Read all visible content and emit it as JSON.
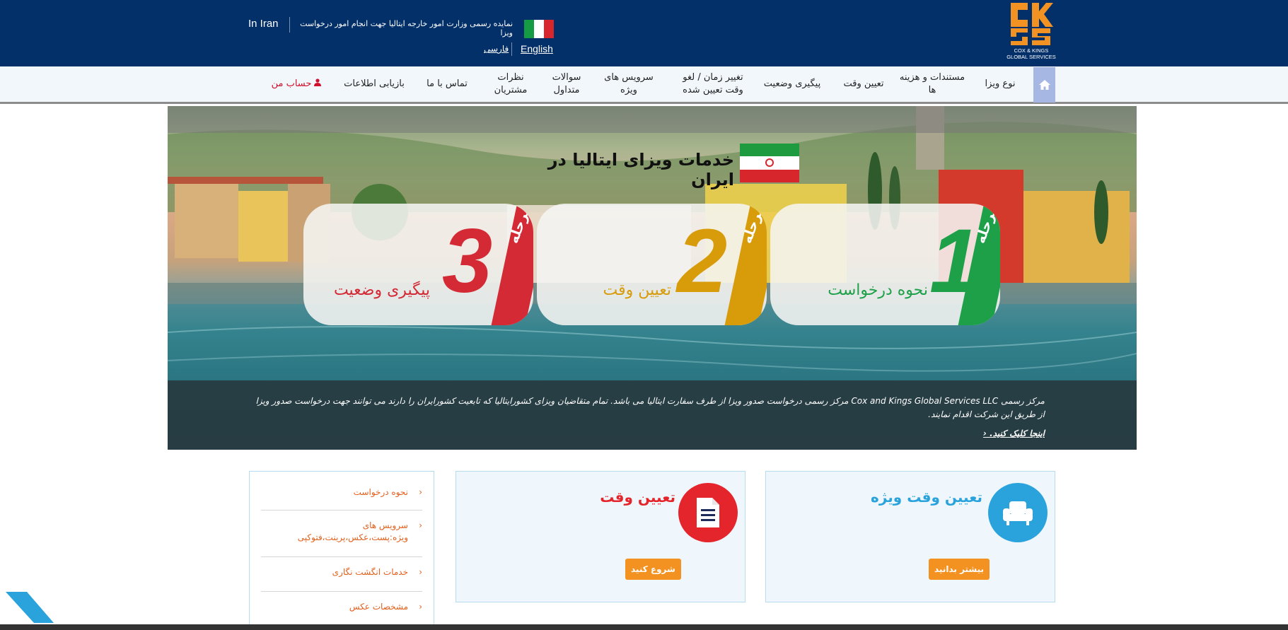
{
  "colors": {
    "header_bg": "#04306a",
    "nav_bg": "#f1f7fb",
    "accent_orange": "#f39221",
    "step1": "#1ea049",
    "step2": "#d89b0a",
    "step3": "#d42a35",
    "account_red": "#d0102c",
    "light_blue": "#2aa3dd",
    "red_circle": "#e4252c"
  },
  "header": {
    "logo": {
      "name": "cox-and-kings-logo",
      "line1": "COX & KINGS",
      "line2": "GLOBAL SERVICES"
    },
    "rep_text": "نمایده رسمی وزارت امور خارجه ایتالیا جهت انجام امور درخواست ویزا",
    "in_iran": "In Iran",
    "lang_english": "English",
    "lang_farsi": "فارسی"
  },
  "nav": {
    "home_icon": "home-icon",
    "items": [
      {
        "label": "نوع ویزا"
      },
      {
        "label": "مستندات و هزینه ها"
      },
      {
        "label": "تعیین وقت"
      },
      {
        "label": "پیگیری وضعیت"
      },
      {
        "label": "تغییر زمان / لغو وقت تعیین شده"
      },
      {
        "label": "سرویس های ویژه"
      },
      {
        "label": "سوالات متداول"
      },
      {
        "label": "نظرات مشتریان"
      },
      {
        "label": "تماس با ما"
      },
      {
        "label": "بازیابی اطلاعات"
      },
      {
        "label": "حساب من"
      }
    ],
    "account_icon": "user-icon"
  },
  "banner": {
    "title": "خدمات ویزای ایتالیا در ایران",
    "steps": [
      {
        "word": "مرحله",
        "number": "1",
        "label": "نحوه درخواست"
      },
      {
        "word": "مرحله",
        "number": "2",
        "label": "تعیین وقت"
      },
      {
        "word": "مرحله",
        "number": "3",
        "label": "پیگیری وضعیت"
      }
    ],
    "info_text": "مرکز رسمی Cox and Kings Global Services LLC مرکز رسمی درخواست صدور ویزا از طرف سفارت ایتالیا می باشد. تمام متقاضیان ویزای کشورایتالیا که تابعیت کشورایران را دارند می توانند جهت درخواست صدور ویزا از طریق این شرکت اقدام نمایند.",
    "link_text": "اینجا کلیک کنید."
  },
  "panels": {
    "premium": {
      "title": "تعیین وقت ویژه",
      "button": "بیشتر بدانید",
      "icon": "armchair-icon"
    },
    "appointment": {
      "title": "تعیین وقت",
      "button": "شروع کنید",
      "icon": "document-icon"
    }
  },
  "side_menu": {
    "items": [
      {
        "label": "نحوه درخواست"
      },
      {
        "label": "سرویس های ویژه:پست،عکس،پرینت،فتوکپی"
      },
      {
        "label": "خدمات انگشت نگاری"
      },
      {
        "label": "مشخصات عکس"
      }
    ]
  }
}
